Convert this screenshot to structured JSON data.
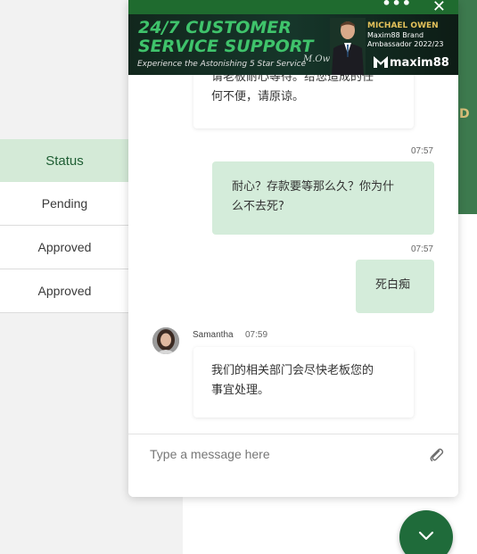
{
  "background": {
    "partial_text": "D",
    "status_table": {
      "header": "Status",
      "rows": [
        "Pending",
        "Approved",
        "Approved"
      ]
    }
  },
  "chat": {
    "banner": {
      "headline_line1": "24/7 CUSTOMER",
      "headline_line2": "SERVICE SUPPORT",
      "tagline": "Experience the Astonishing 5 Star Service",
      "ambassador_name": "MICHAEL OWEN",
      "ambassador_line1": "Maxim88 Brand",
      "ambassador_line2": "Ambassador 2022/23",
      "logo_text": "maxim88"
    },
    "messages": [
      {
        "from": "agent",
        "text_line1": "请老板耐心等待。给您造成的任",
        "text_line2": "何不便，请原谅。"
      },
      {
        "from": "user",
        "time": "07:57",
        "text_line1": "耐心？存款要等那么久？你为什",
        "text_line2": "么不去死?"
      },
      {
        "from": "user",
        "time": "07:57",
        "text_line1": "死白痴"
      },
      {
        "from": "agent",
        "agent_name": "Samantha",
        "time": "07:59",
        "text_line1": "我们的相关部门会尽快老板您的",
        "text_line2": "事宜处理。"
      }
    ],
    "input": {
      "placeholder": "Type a message here",
      "value": ""
    },
    "icons": {
      "more": "more-icon",
      "close": "close-icon",
      "attach": "paperclip-icon",
      "fab": "chevron-down-icon"
    },
    "colors": {
      "brand_green": "#1f6b2f",
      "user_bubble": "#d4ecda",
      "banner_headline": "#3fc36b",
      "ambassador_gold": "#e3c15a"
    }
  }
}
